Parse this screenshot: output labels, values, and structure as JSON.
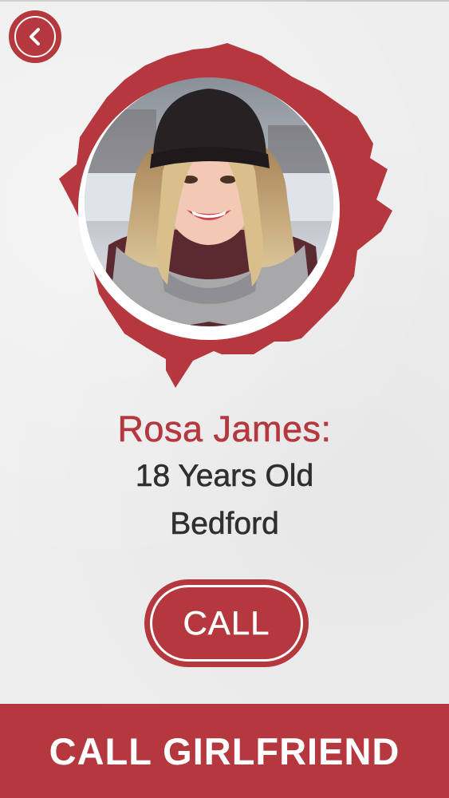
{
  "colors": {
    "accent": "#b5383f",
    "text_dark": "#2f2f2f",
    "background": "#efeeef",
    "white": "#ffffff"
  },
  "header": {
    "back_icon": "chevron-left-icon"
  },
  "profile": {
    "photo_description_icon": "avatar-photo",
    "name": "Rosa James:",
    "age": "18 Years Old",
    "city": "Bedford"
  },
  "actions": {
    "call_label": "CALL"
  },
  "footer": {
    "title": "CALL GIRLFRIEND"
  }
}
